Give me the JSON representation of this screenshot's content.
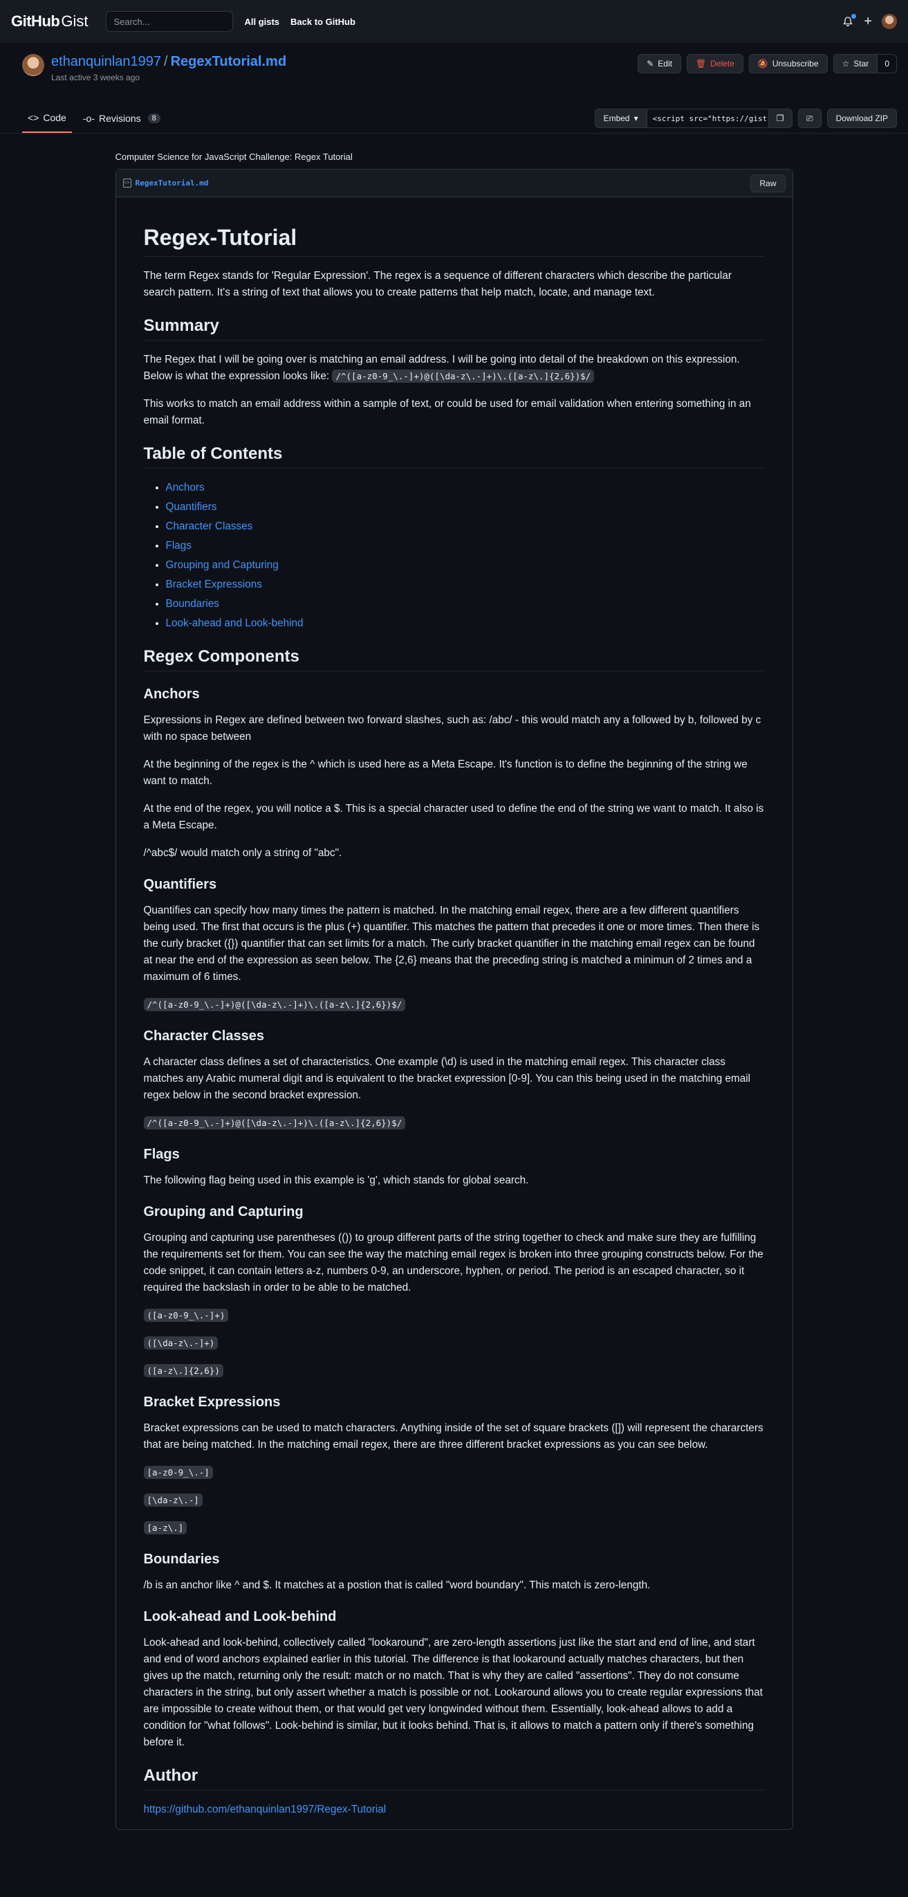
{
  "header": {
    "logo_bold": "GitHub",
    "logo_light": "Gist",
    "search_placeholder": "Search...",
    "links": [
      "All gists",
      "Back to GitHub"
    ]
  },
  "gist": {
    "owner": "ethanquinlan1997",
    "separator": "/",
    "name": "RegexTutorial.md",
    "last_active": "Last active 3 weeks ago",
    "actions": {
      "edit": "Edit",
      "delete": "Delete",
      "unsubscribe": "Unsubscribe",
      "star": "Star",
      "star_count": "0"
    },
    "tabs": {
      "code": "Code",
      "revisions": "Revisions",
      "revisions_count": "8"
    },
    "embed": {
      "label": "Embed",
      "value": "<script src=\"https://gist"
    },
    "download": "Download ZIP",
    "description": "Computer Science for JavaScript Challenge: Regex Tutorial",
    "file": {
      "name": "RegexTutorial.md",
      "raw": "Raw"
    }
  },
  "doc": {
    "title": "Regex-Tutorial",
    "intro": "The term Regex stands for 'Regular Expression'. The regex is a sequence of different characters which describe the particular search pattern. It's a string of text that allows you to create patterns that help match, locate, and manage text.",
    "summary_h": "Summary",
    "summary_p1_text": "The Regex that I will be going over is matching an email address. I will be going into detail of the breakdown on this expression. Below is what the expression looks like: ",
    "summary_p1_code": "/^([a-z0-9_\\.-]+)@([\\da-z\\.-]+)\\.([a-z\\.]{2,6})$/",
    "summary_p2": "This works to match an email address within a sample of text, or could be used for email validation when entering something in an email format.",
    "toc_h": "Table of Contents",
    "toc": [
      "Anchors",
      "Quantifiers",
      "Character Classes",
      "Flags",
      "Grouping and Capturing",
      "Bracket Expressions",
      "Boundaries",
      "Look-ahead and Look-behind"
    ],
    "components_h": "Regex Components",
    "anchors_h": "Anchors",
    "anchors_p1": "Expressions in Regex are defined between two forward slashes, such as: /abc/ - this would match any a followed by b, followed by c with no space between",
    "anchors_p2": "At the beginning of the regex is the ^ which is used here as a Meta Escape. It's function is to define the beginning of the string we want to match.",
    "anchors_p3": "At the end of the regex, you will notice a $. This is a special character used to define the end of the string we want to match. It also is a Meta Escape.",
    "anchors_p4": "/^abc$/ would match only a string of \"abc\".",
    "quant_h": "Quantifiers",
    "quant_p": "Quantifies can specify how many times the pattern is matched. In the matching email regex, there are a few different quantifiers being used. The first that occurs is the plus (+) quantifier. This matches the pattern that precedes it one or more times. Then there is the curly bracket ({}) quantifier that can set limits for a match. The curly bracket quantifier in the matching email regex can be found at near the end of the expression as seen below. The {2,6} means that the preceding string is matched a minimun of 2 times and a maximum of 6 times.",
    "quant_code": "/^([a-z0-9_\\.-]+)@([\\da-z\\.-]+)\\.([a-z\\.]{2,6})$/",
    "cc_h": "Character Classes",
    "cc_p": "A character class defines a set of characteristics. One example (\\d) is used in the matching email regex. This character class matches any Arabic mumeral digit and is equivalent to the bracket expression [0-9]. You can this being used in the matching email regex below in the second bracket expression.",
    "cc_code": "/^([a-z0-9_\\.-]+)@([\\da-z\\.-]+)\\.([a-z\\.]{2,6})$/",
    "flags_h": "Flags",
    "flags_p": "The following flag being used in this example is 'g', which stands for global search.",
    "group_h": "Grouping and Capturing",
    "group_p": "Grouping and capturing use parentheses (()) to group different parts of the string together to check and make sure they are fulfilling the requirements set for them. You can see the way the matching email regex is broken into three grouping constructs below. For the code snippet, it can contain letters a-z, numbers 0-9, an underscore, hyphen, or period. The period is an escaped character, so it required the backslash in order to be able to be matched.",
    "group_codes": [
      "([a-z0-9_\\.-]+)",
      "([\\da-z\\.-]+)",
      "([a-z\\.]{2,6})"
    ],
    "bracket_h": "Bracket Expressions",
    "bracket_p": "Bracket expressions can be used to match characters. Anything inside of the set of square brackets ([]) will represent the chararcters that are being matched. In the matching email regex, there are three different bracket expressions as you can see below.",
    "bracket_codes": [
      "[a-z0-9_\\.-]",
      "[\\da-z\\.-]",
      "[a-z\\.]"
    ],
    "bound_h": "Boundaries",
    "bound_p": "/b is an anchor like ^ and $. It matches at a postion that is called \"word boundary\". This match is zero-length.",
    "look_h": "Look-ahead and Look-behind",
    "look_p": "Look-ahead and look-behind, collectively called \"lookaround\", are zero-length assertions just like the start and end of line, and start and end of word anchors explained earlier in this tutorial. The difference is that lookaround actually matches characters, but then gives up the match, returning only the result: match or no match. That is why they are called \"assertions\". They do not consume characters in the string, but only assert whether a match is possible or not. Lookaround allows you to create regular expressions that are impossible to create without them, or that would get very longwinded without them. Essentially, look-ahead allows to add a condition for \"what follows\". Look-behind is similar, but it looks behind. That is, it allows to match a pattern only if there's something before it.",
    "author_h": "Author",
    "author_link": "https://github.com/ethanquinlan1997/Regex-Tutorial"
  },
  "colors": {
    "bg": "#0d1117",
    "header": "#161b22",
    "link": "#4493f8",
    "danger": "#f85149",
    "tab_underline": "#f78166"
  }
}
